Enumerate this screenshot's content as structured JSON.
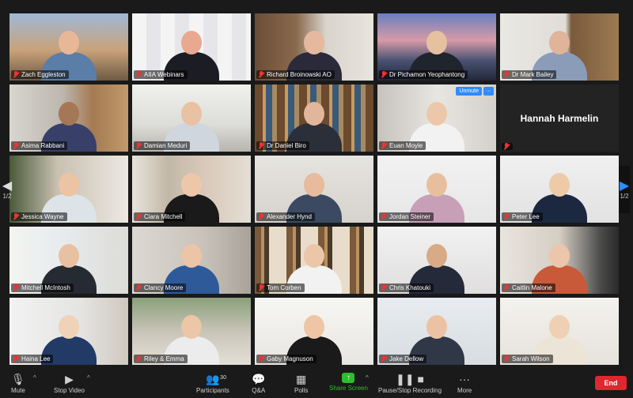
{
  "participants": [
    {
      "name": "Zach Eggleston",
      "scene": "city",
      "skin": "#e8b896",
      "shirt": "#5a7ea8"
    },
    {
      "name": "AIIA Webinars",
      "scene": "backdrop",
      "skin": "#e8a98e",
      "shirt": "#1c1c24",
      "active": true
    },
    {
      "name": "Richard Broinowski AO",
      "scene": "office",
      "skin": "#e6b8a0",
      "shirt": "#2a2a3a"
    },
    {
      "name": "Dr Pichamon Yeophantong",
      "scene": "skyline",
      "skin": "#e6c1a0",
      "shirt": "#20242c"
    },
    {
      "name": "Dr Mark Bailey",
      "scene": "books",
      "skin": "#e0b498",
      "shirt": "#8a9cb8"
    },
    {
      "name": "Asima Rabbani",
      "scene": "shelf",
      "skin": "#a57755",
      "shirt": "#38406a"
    },
    {
      "name": "Damian Meduri",
      "scene": "office2",
      "skin": "#e8c2a2",
      "shirt": "#cfd6de"
    },
    {
      "name": "Dr Daniel Biro",
      "scene": "bookcase",
      "skin": "#e2b69a",
      "shirt": "#2a2f3a"
    },
    {
      "name": "Euan Moyle",
      "scene": "room",
      "skin": "#edc7aa",
      "shirt": "#f2f2f2",
      "unmute": true
    },
    {
      "name": "Hannah Harmelin",
      "scene": "nameonly"
    },
    {
      "name": "Jessica Wayne",
      "scene": "plants",
      "skin": "#ecc4a4",
      "shirt": "#dde4e8"
    },
    {
      "name": "Ciara Mitchell",
      "scene": "posters",
      "skin": "#eec7aa",
      "shirt": "#1a1a1a"
    },
    {
      "name": "Alexander Hynd",
      "scene": "wall",
      "skin": "#e7bb9c",
      "shirt": "#3b4a62"
    },
    {
      "name": "Jordan Steiner",
      "scene": "white",
      "skin": "#e8bf9e",
      "shirt": "#c7a0b8"
    },
    {
      "name": "Peter Lee",
      "scene": "white2",
      "skin": "#edcba8",
      "shirt": "#1c2840"
    },
    {
      "name": "Mitchell McIntosh",
      "scene": "window",
      "skin": "#e8c0a2",
      "shirt": "#262a33"
    },
    {
      "name": "Clancy Moore",
      "scene": "room2",
      "skin": "#ecc4a6",
      "shirt": "#2f5a9a"
    },
    {
      "name": "Tom Corben",
      "scene": "bookcase2",
      "skin": "#ecc6a8",
      "shirt": "#f2f2f2"
    },
    {
      "name": "Chris Khatouki",
      "scene": "white3",
      "skin": "#d8aa86",
      "shirt": "#242a3a"
    },
    {
      "name": "Caitlin Malone",
      "scene": "kitchen",
      "skin": "#ecc6aa",
      "shirt": "#c85a3a"
    },
    {
      "name": "Haina Lee",
      "scene": "door",
      "skin": "#efd2b8",
      "shirt": "#223a66"
    },
    {
      "name": "Riley & Emma",
      "scene": "garden",
      "skin": "#ecc6a6",
      "shirt": "#ececec"
    },
    {
      "name": "Gaby Magnuson",
      "scene": "bright",
      "skin": "#eec6a6",
      "shirt": "#1a1a1a"
    },
    {
      "name": "Jake Dellow",
      "scene": "blue",
      "skin": "#ecc2a4",
      "shirt": "#303848"
    },
    {
      "name": "Sarah Wilson",
      "scene": "light",
      "skin": "#efd0b2",
      "shirt": "#ede4d8"
    }
  ],
  "nav": {
    "left_page": "1/2",
    "right_page": "1/2"
  },
  "toolbar": {
    "mute": "Mute",
    "stop_video": "Stop Video",
    "participants": "Participants",
    "participants_count": "30",
    "qa": "Q&A",
    "polls": "Polls",
    "share_screen": "Share Screen",
    "pause_recording": "Pause/Stop Recording",
    "more": "More",
    "end": "End"
  },
  "tile_controls": {
    "unmute": "Unmute",
    "more": "···"
  },
  "colors": {
    "accent": "#2d8cff",
    "share": "#2dbe2d",
    "end": "#e0262f",
    "active_speaker": "#c4d94a",
    "muted": "#e33"
  }
}
